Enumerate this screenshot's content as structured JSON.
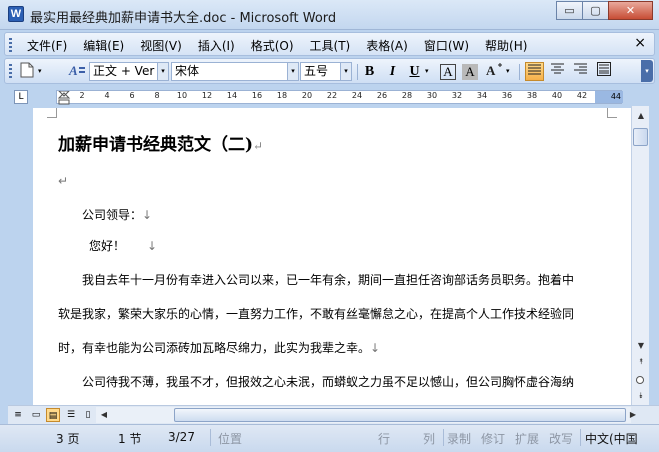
{
  "window": {
    "title": "最实用最经典加薪申请书大全.doc - Microsoft Word",
    "app_icon": "W",
    "buttons": {
      "minimize": "▭",
      "maximize": "▢",
      "close": "✕"
    }
  },
  "menu": {
    "items": [
      "文件(F)",
      "编辑(E)",
      "视图(V)",
      "插入(I)",
      "格式(O)",
      "工具(T)",
      "表格(A)",
      "窗口(W)",
      "帮助(H)"
    ],
    "close_glyph": "×"
  },
  "toolbar": {
    "style_value": "正文 + Ver",
    "font_value": "宋体",
    "size_value": "五号",
    "bold": "B",
    "italic": "I",
    "underline": "U",
    "char_border": "A",
    "char_shading": "A",
    "dropdown_glyph": "▾"
  },
  "ruler": {
    "tab_glyph": "L",
    "labels": [
      "2",
      "4",
      "6",
      "8",
      "10",
      "12",
      "14",
      "16",
      "18",
      "20",
      "22",
      "24",
      "26",
      "28",
      "30",
      "32",
      "34",
      "36",
      "38",
      "40",
      "42",
      "44"
    ]
  },
  "document": {
    "title": "加薪申请书经典范文（二)",
    "para_mark": "↵",
    "line_mark": "↓",
    "lines": [
      "公司领导：",
      "您好！",
      "我自去年十一月份有幸进入公司以来，已一年有余，期间一直担任咨询部话务员职务。抱着中",
      "软是我家，繁荣大家乐的心情，一直努力工作，不敢有丝毫懈怠之心，在提高个人工作技术经验同",
      "时，有幸也能为公司添砖加瓦略尽绵力，此实为我辈之幸。",
      "公司待我不薄，我虽不才，但报效之心未泯，而蟒蚁之力虽不足以憾山，但公司胸怀虚谷海纳"
    ]
  },
  "status": {
    "page": "3 页",
    "section": "1 节",
    "page_of": "3/27",
    "position": "位置",
    "line": "行",
    "column": "列",
    "record": "录制",
    "revise": "修订",
    "extend": "扩展",
    "overwrite": "改写",
    "language": "中文(中国"
  },
  "colors": {
    "chrome": "#bcd3ee",
    "accent_active": "#f5b04a"
  }
}
